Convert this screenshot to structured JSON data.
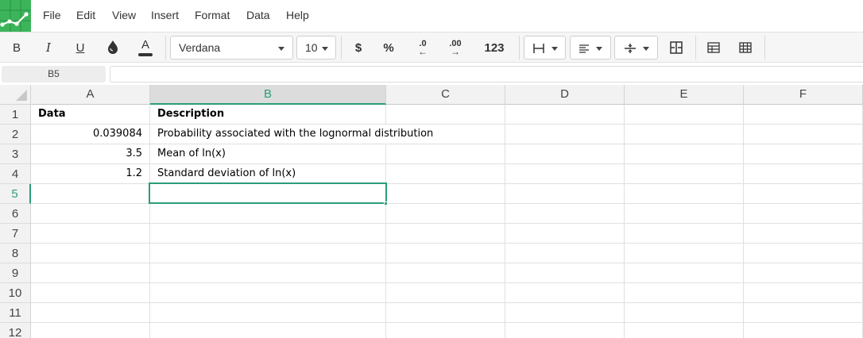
{
  "menu": [
    "File",
    "Edit",
    "View",
    "Insert",
    "Format",
    "Data",
    "Help"
  ],
  "toolbar": {
    "bold": "B",
    "italic": "I",
    "underline": "U",
    "text_color": "A",
    "font_family": "Verdana",
    "font_size": "10",
    "currency": "$",
    "percent": "%",
    "decrease_decimals": ".0",
    "increase_decimals": ".00",
    "number_format": "123"
  },
  "name_box": "B5",
  "formula": "",
  "columns": [
    "A",
    "B",
    "C",
    "D",
    "E",
    "F"
  ],
  "rows": [
    "1",
    "2",
    "3",
    "4",
    "5",
    "6",
    "7",
    "8",
    "9",
    "10",
    "11",
    "12"
  ],
  "cells": {
    "A1": "Data",
    "B1": "Description",
    "A2": "0.039084",
    "B2": "Probability associated with the lognormal distribution",
    "A3": "3.5",
    "B3": "Mean of ln(x)",
    "A4": "1.2",
    "B4": "Standard deviation of ln(x)"
  },
  "selected_cell": "B5",
  "colors": {
    "accent": "#2a9d7b",
    "logo": "#3cb55a"
  }
}
